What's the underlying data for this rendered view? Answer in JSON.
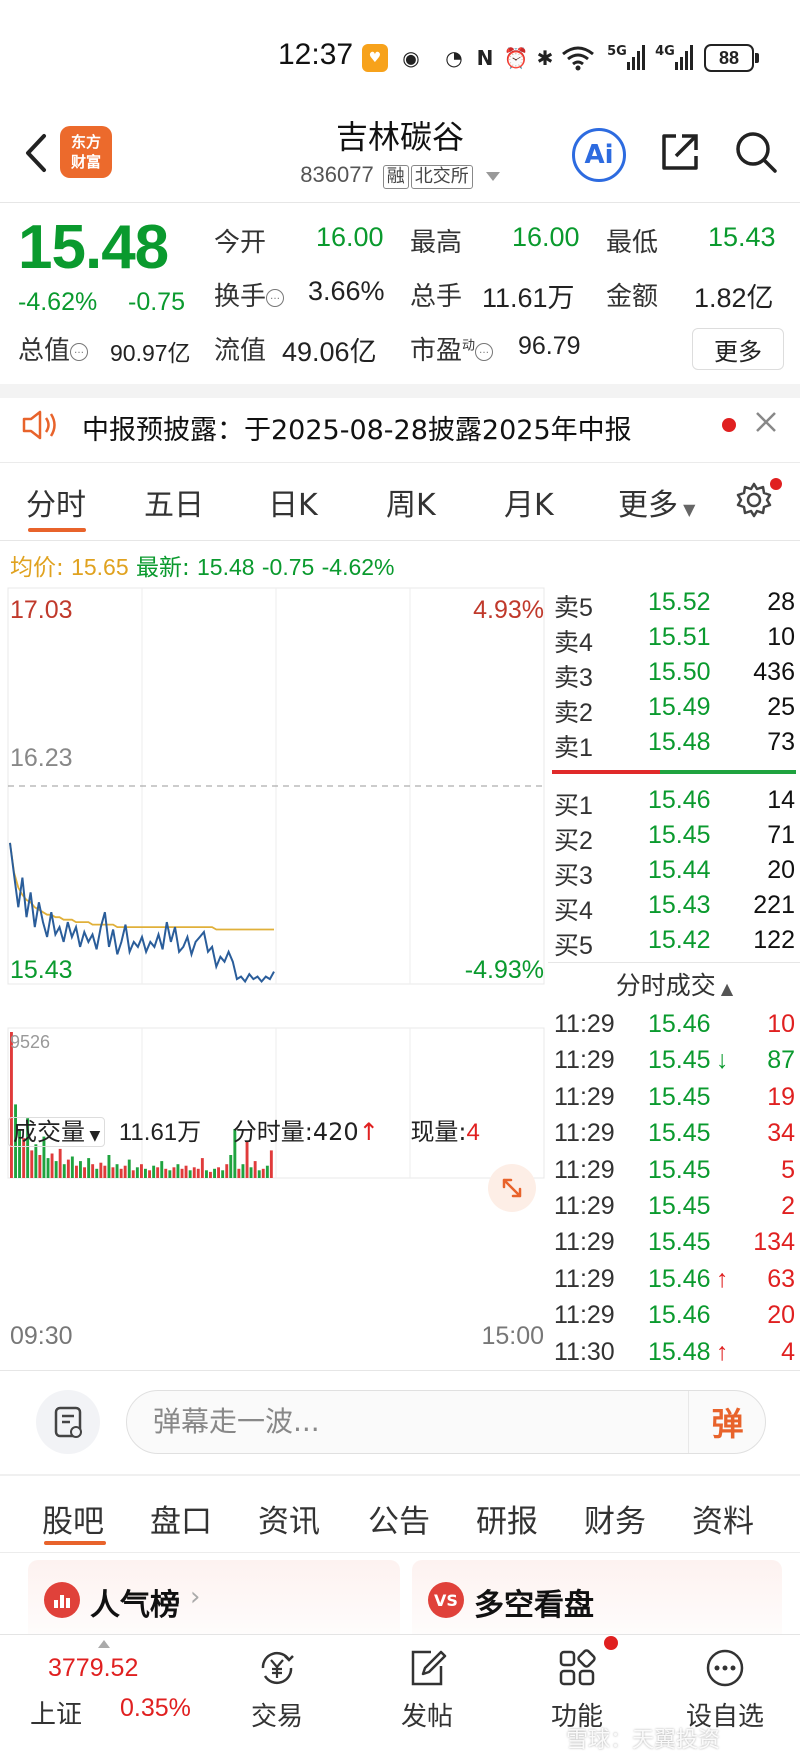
{
  "status_bar": {
    "time": "12:37",
    "battery": "88",
    "network": [
      "5G",
      "4G"
    ]
  },
  "header": {
    "logo_text": "东方财富",
    "stock_name": "吉林碳谷",
    "stock_code": "836077",
    "tags": [
      "融",
      "北交所"
    ],
    "ai_label": "Ai"
  },
  "quote": {
    "price": "15.48",
    "change_pct": "-4.62%",
    "change_abs": "-0.75",
    "fields": [
      {
        "label": "今开",
        "value": "16.00",
        "color": "green"
      },
      {
        "label": "最高",
        "value": "16.00",
        "color": "green"
      },
      {
        "label": "最低",
        "value": "15.43",
        "color": "green"
      },
      {
        "label": "换手",
        "value": "3.66%",
        "color": "black"
      },
      {
        "label": "总手",
        "value": "11.61万",
        "color": "black"
      },
      {
        "label": "金额",
        "value": "1.82亿",
        "color": "black"
      },
      {
        "label": "总值",
        "value": "90.97亿",
        "color": "black"
      },
      {
        "label": "流值",
        "value": "49.06亿",
        "color": "black"
      },
      {
        "label": "市盈",
        "value": "96.79",
        "color": "black"
      }
    ],
    "pe_sup": "动",
    "more_label": "更多"
  },
  "notice": {
    "text": "中报预披露：于2025-08-28披露2025年中报"
  },
  "tabs": [
    "分时",
    "五日",
    "日K",
    "周K",
    "月K",
    "更多"
  ],
  "avg_row": {
    "avg_label": "均价:",
    "avg_value": "15.65",
    "latest_label": "最新:",
    "latest_value": "15.48",
    "latest_chg": "-0.75",
    "latest_pct": "-4.62%"
  },
  "chart": {
    "top_price": "17.03",
    "top_pct": "4.93%",
    "mid_price": "16.23",
    "bottom_price": "15.43",
    "bottom_pct": "-4.93%",
    "vol_label": "成交量",
    "vol_value": "11.61万",
    "tick_vol_label": "分时量:420",
    "now_vol_label": "现量:",
    "now_vol_value": "4",
    "vol_max": "9526",
    "time_start": "09:30",
    "time_end": "15:00"
  },
  "chart_data": {
    "type": "line",
    "ylim": [
      15.43,
      17.03
    ],
    "prev_close": 16.23,
    "series": [
      {
        "values": [
          16.0,
          15.87,
          15.74,
          15.86,
          15.7,
          15.8,
          15.66,
          15.76,
          15.68,
          15.62,
          15.72,
          15.63,
          15.66,
          15.6,
          15.68,
          15.62,
          15.66,
          15.58,
          15.64,
          15.6,
          15.63,
          15.57,
          15.66,
          15.72,
          15.58,
          15.65,
          15.55,
          15.6,
          15.67,
          15.56,
          15.6,
          15.58,
          15.62,
          15.56,
          15.6,
          15.58,
          15.63,
          15.57,
          15.68,
          15.6,
          15.66,
          15.56,
          15.58,
          15.62,
          15.55,
          15.6,
          15.62,
          15.64,
          15.56,
          15.58,
          15.5,
          15.54,
          15.52,
          15.56,
          15.52,
          15.45,
          15.46,
          15.44,
          15.47,
          15.45,
          15.46,
          15.44,
          15.46,
          15.45,
          15.48
        ]
      },
      {
        "values": [
          16.0,
          15.88,
          15.82,
          15.79,
          15.77,
          15.76,
          15.74,
          15.73,
          15.72,
          15.71,
          15.71,
          15.7,
          15.7,
          15.69,
          15.69,
          15.69,
          15.68,
          15.68,
          15.68,
          15.68,
          15.67,
          15.67,
          15.67,
          15.67,
          15.67,
          15.67,
          15.66,
          15.66,
          15.66,
          15.66,
          15.66,
          15.66,
          15.66,
          15.66,
          15.66,
          15.66,
          15.66,
          15.66,
          15.66,
          15.66,
          15.66,
          15.66,
          15.66,
          15.66,
          15.66,
          15.66,
          15.66,
          15.66,
          15.66,
          15.66,
          15.65,
          15.65,
          15.65,
          15.65,
          15.65,
          15.65,
          15.65,
          15.65,
          15.65,
          15.65,
          15.65,
          15.65,
          15.65,
          15.65,
          15.65
        ]
      }
    ],
    "volume": [
      9526,
      4800,
      3200,
      2600,
      3900,
      1800,
      2200,
      1500,
      2700,
      1300,
      1600,
      1100,
      1900,
      900,
      1200,
      1400,
      800,
      1100,
      700,
      1300,
      900,
      600,
      1000,
      800,
      1500,
      700,
      900,
      600,
      800,
      1200,
      500,
      700,
      900,
      600,
      500,
      800,
      700,
      1100,
      600,
      500,
      700,
      900,
      600,
      800,
      500,
      700,
      600,
      1300,
      500,
      400,
      600,
      700,
      500,
      900,
      1500,
      3200,
      600,
      900,
      2400,
      700,
      1100,
      500,
      600,
      800,
      1800
    ]
  },
  "order_book": {
    "asks": [
      {
        "label": "卖5",
        "price": "15.52",
        "qty": "28"
      },
      {
        "label": "卖4",
        "price": "15.51",
        "qty": "10"
      },
      {
        "label": "卖3",
        "price": "15.50",
        "qty": "436"
      },
      {
        "label": "卖2",
        "price": "15.49",
        "qty": "25"
      },
      {
        "label": "卖1",
        "price": "15.48",
        "qty": "73"
      }
    ],
    "bids": [
      {
        "label": "买1",
        "price": "15.46",
        "qty": "14"
      },
      {
        "label": "买2",
        "price": "15.45",
        "qty": "71"
      },
      {
        "label": "买3",
        "price": "15.44",
        "qty": "20"
      },
      {
        "label": "买4",
        "price": "15.43",
        "qty": "221"
      },
      {
        "label": "买5",
        "price": "15.42",
        "qty": "122"
      }
    ],
    "ticks_title": "分时成交",
    "ticks": [
      {
        "time": "11:29",
        "price": "15.46",
        "flag": "",
        "vol": "10",
        "vol_color": "red"
      },
      {
        "time": "11:29",
        "price": "15.45",
        "flag": "↓",
        "vol": "87",
        "vol_color": "green"
      },
      {
        "time": "11:29",
        "price": "15.45",
        "flag": "",
        "vol": "19",
        "vol_color": "red"
      },
      {
        "time": "11:29",
        "price": "15.45",
        "flag": "",
        "vol": "34",
        "vol_color": "red"
      },
      {
        "time": "11:29",
        "price": "15.45",
        "flag": "",
        "vol": "5",
        "vol_color": "red"
      },
      {
        "time": "11:29",
        "price": "15.45",
        "flag": "",
        "vol": "2",
        "vol_color": "red"
      },
      {
        "time": "11:29",
        "price": "15.45",
        "flag": "",
        "vol": "134",
        "vol_color": "red"
      },
      {
        "time": "11:29",
        "price": "15.46",
        "flag": "↑",
        "vol": "63",
        "vol_color": "red"
      },
      {
        "time": "11:29",
        "price": "15.46",
        "flag": "",
        "vol": "20",
        "vol_color": "red"
      },
      {
        "time": "11:30",
        "price": "15.48",
        "flag": "↑",
        "vol": "4",
        "vol_color": "red"
      }
    ]
  },
  "danmaku": {
    "placeholder": "弹幕走一波...",
    "button": "弹"
  },
  "lower_tabs": [
    "股吧",
    "盘口",
    "资讯",
    "公告",
    "研报",
    "财务",
    "资料"
  ],
  "cards": [
    {
      "title": "人气榜"
    },
    {
      "title": "多空看盘",
      "icon": "VS"
    }
  ],
  "bottom_nav": {
    "index_value": "3779.52",
    "index_name": "上证",
    "index_pct": "0.35%",
    "items": [
      "交易",
      "发帖",
      "功能",
      "设自选"
    ]
  },
  "watermark": "雪球：天翼投资",
  "colors": {
    "up": "#e02020",
    "down": "#0a9a2e",
    "accent": "#e8632b",
    "price_line": "#2a5d9a",
    "avg_line": "#e0b03a"
  }
}
